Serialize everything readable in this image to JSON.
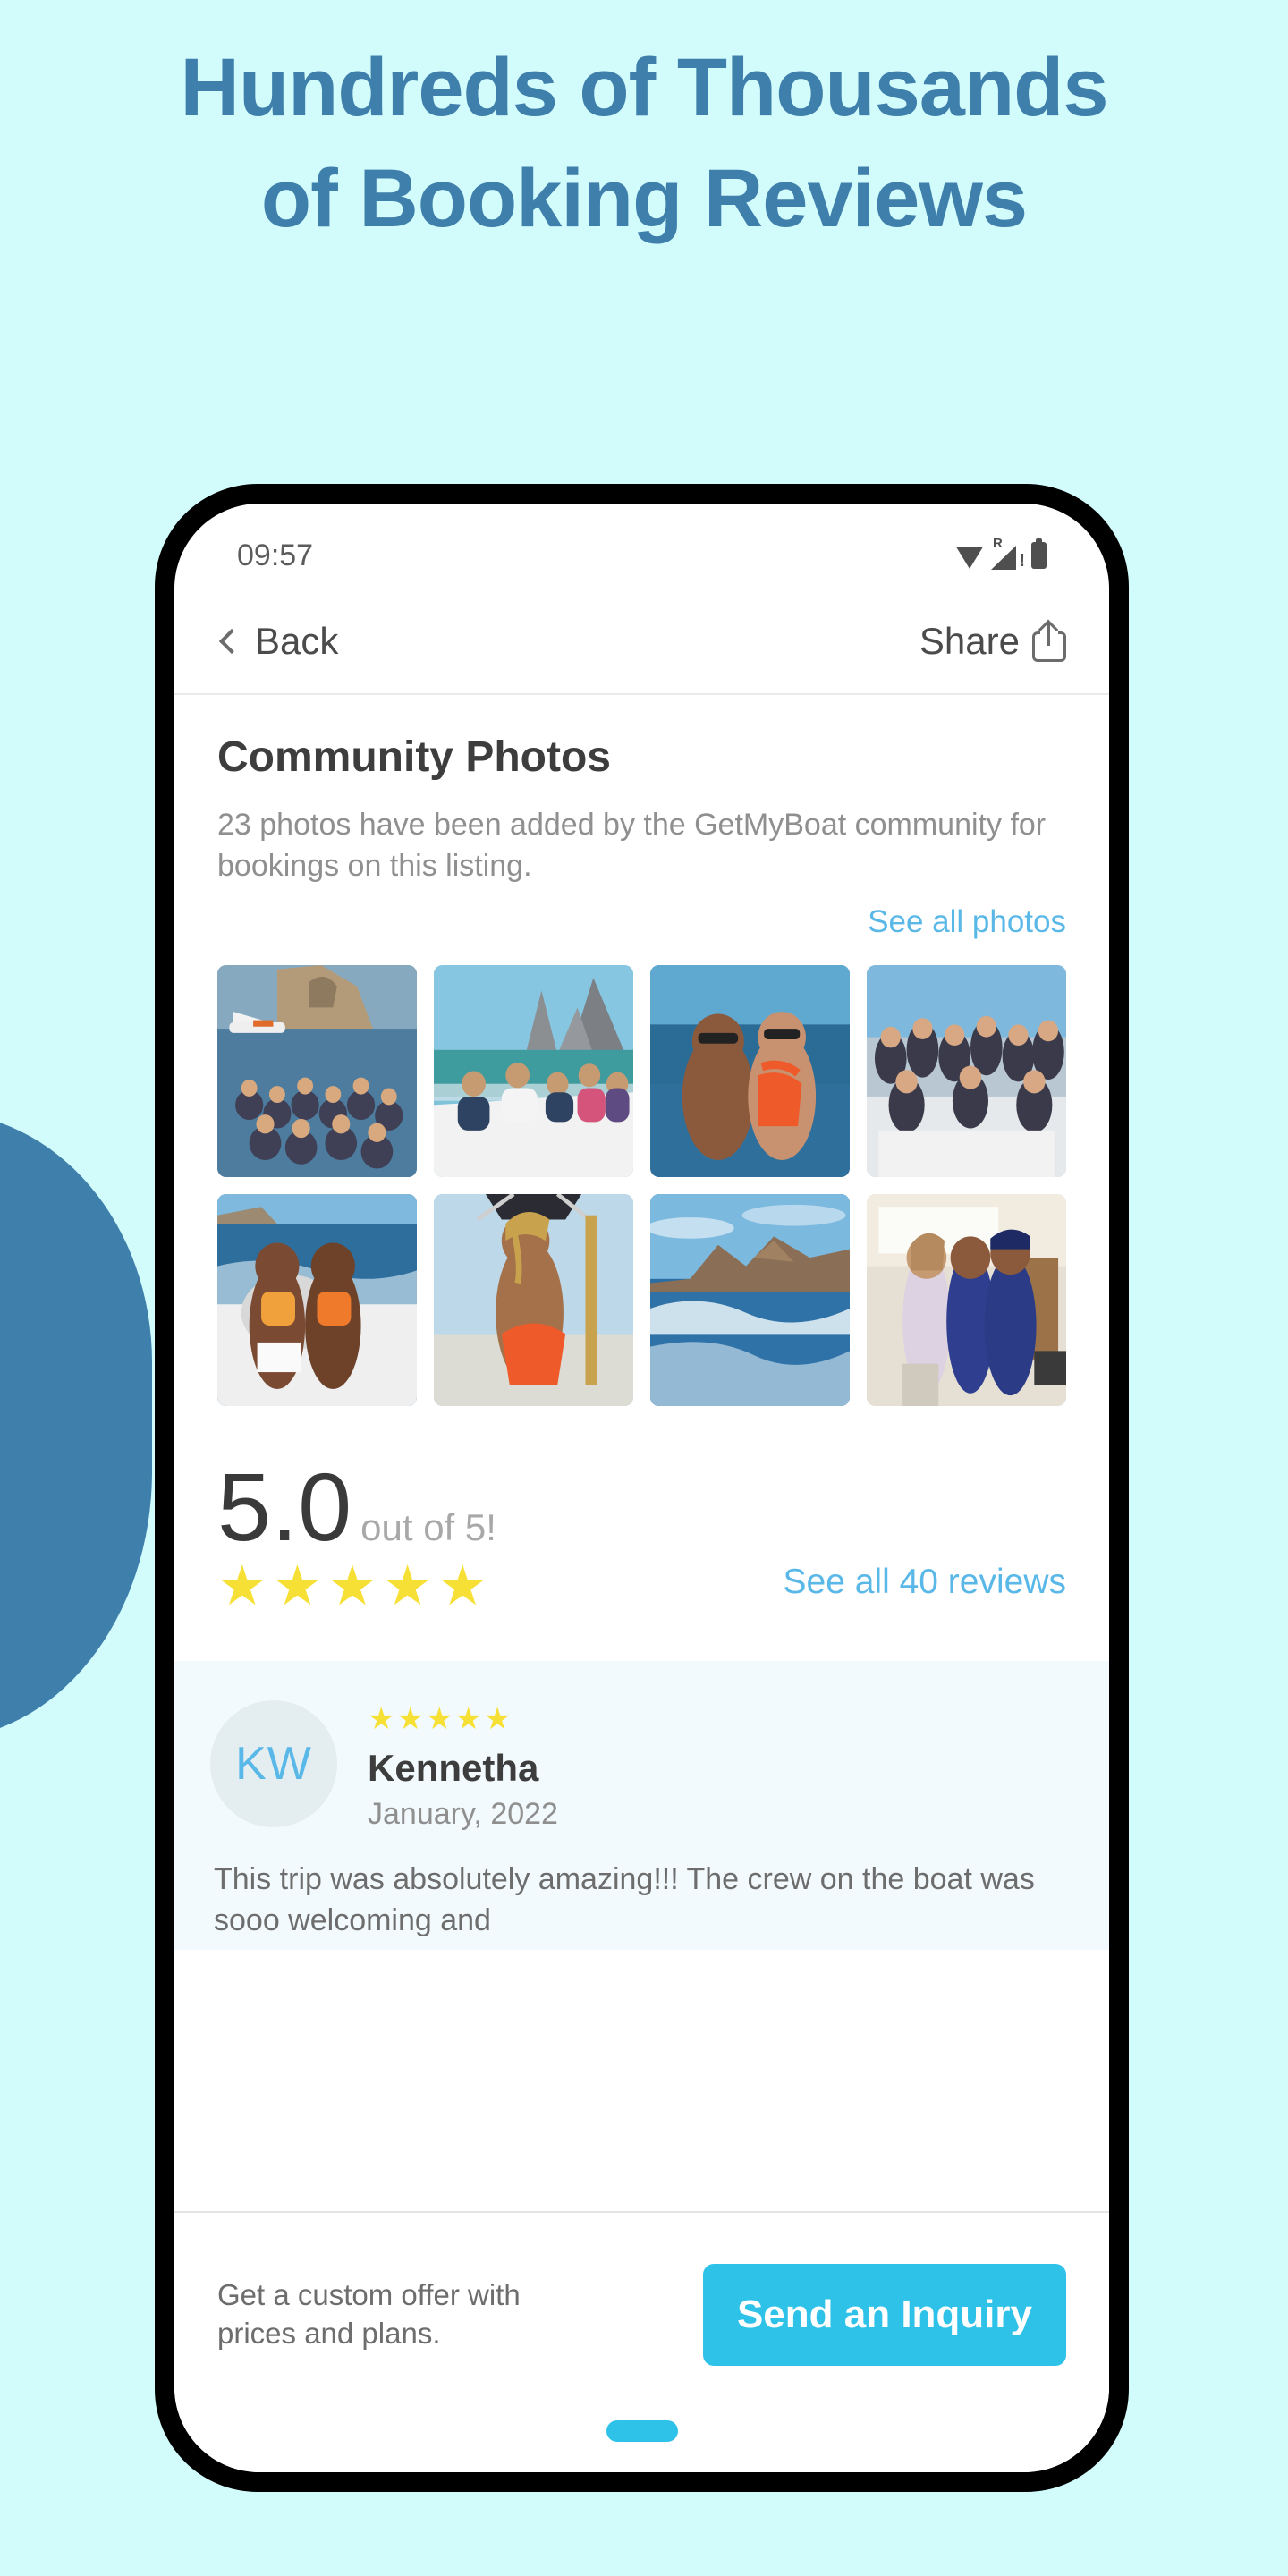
{
  "page": {
    "headline_line1": "Hundreds of Thousands",
    "headline_line2": "of Booking Reviews",
    "background_color": "#d2fbfc",
    "accent_color": "#3e7fab"
  },
  "status_bar": {
    "time": "09:57",
    "icons": [
      "wifi-icon",
      "signal-roaming-icon",
      "battery-icon"
    ],
    "roaming_label": "R"
  },
  "nav": {
    "back_label": "Back",
    "share_label": "Share"
  },
  "community_photos": {
    "title": "Community Photos",
    "description": "23 photos have been added by the GetMyBoat community for bookings on this listing.",
    "see_all_label": "See all photos",
    "photo_count": "23",
    "photos": [
      {
        "alt": "group on sailboat near the Arch at Cabo"
      },
      {
        "alt": "friends lounging on boat bow with rock formations"
      },
      {
        "alt": "couple in swimwear smiling on deck"
      },
      {
        "alt": "group of women posing on yacht"
      },
      {
        "alt": "two women on boat with wake behind"
      },
      {
        "alt": "man in orange shorts seated on sailboat"
      },
      {
        "alt": "rocky coastline and ocean wake"
      },
      {
        "alt": "three friends standing indoors"
      }
    ]
  },
  "rating": {
    "score": "5.0",
    "out_of_label": "out of 5!",
    "stars": "★★★★★",
    "star_color": "#f7e036",
    "see_all_reviews_label": "See all 40 reviews",
    "review_count": "40"
  },
  "review": {
    "avatar_initials": "KW",
    "stars": "★★★★★",
    "name": "Kennetha",
    "date": "January, 2022",
    "body": "This trip was absolutely amazing!!! The crew on the boat was sooo welcoming and"
  },
  "cta": {
    "text": "Get a custom offer with prices and plans.",
    "button_label": "Send an Inquiry",
    "button_color": "#2ec2e8"
  }
}
